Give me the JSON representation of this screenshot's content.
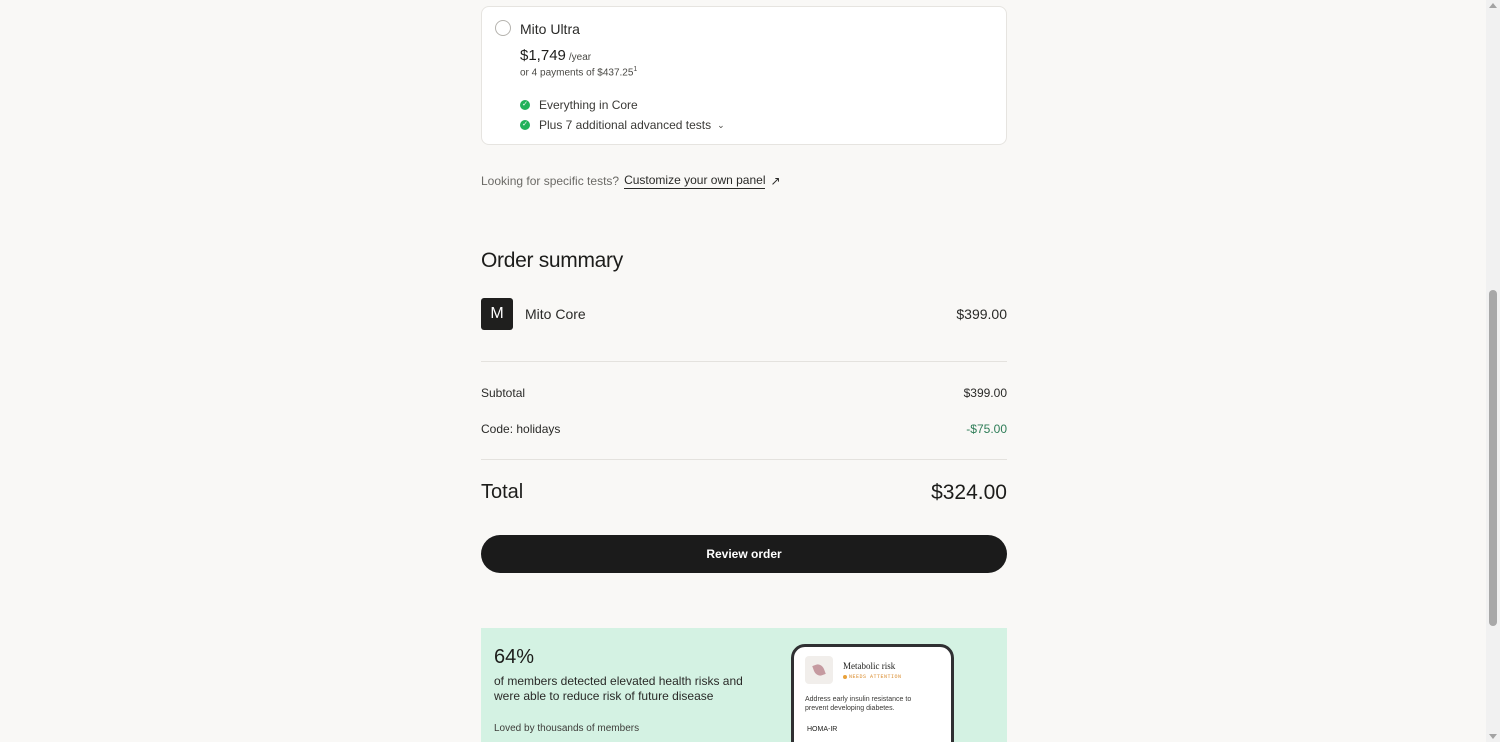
{
  "plan_option": {
    "name": "Mito Ultra",
    "price": "$1,749",
    "price_period": "/year",
    "payments": "or 4 payments of $437.25",
    "payments_footnote": "1",
    "features": [
      {
        "text": "Everything in Core",
        "expandable": false
      },
      {
        "text": "Plus 7 additional advanced tests",
        "expandable": true
      }
    ],
    "selected": false
  },
  "custom_panel": {
    "prompt": "Looking for specific tests?",
    "link_label": "Customize your own panel"
  },
  "order_summary": {
    "title": "Order summary",
    "item": {
      "thumb_letter": "M",
      "name": "Mito Core",
      "price": "$399.00"
    },
    "subtotal_label": "Subtotal",
    "subtotal_value": "$399.00",
    "code_label": "Code: holidays",
    "code_value": "-$75.00",
    "total_label": "Total",
    "total_value": "$324.00"
  },
  "review_button_label": "Review order",
  "promo": {
    "stat": "64%",
    "description": "of members detected elevated health risks and were able to reduce risk of future disease",
    "loved": "Loved by thousands of members",
    "phone": {
      "title": "Metabolic risk",
      "badge": "NEEDS ATTENTION",
      "text": "Address early insulin resistance to prevent developing diabetes.",
      "metric": "HOMA-IR"
    }
  },
  "colors": {
    "background": "#f9f8f6",
    "check_green": "#22b15a",
    "discount_green": "#2e7d57",
    "button_dark": "#1b1b1b",
    "promo_bg": "#d4f2e3",
    "attention_orange": "#e8a13a"
  },
  "icons": {
    "radio": "radio-unselected-icon",
    "check": "check-circle-icon",
    "chevron": "chevron-down-icon",
    "external": "arrow-up-right-icon",
    "leaf": "leaf-icon"
  }
}
